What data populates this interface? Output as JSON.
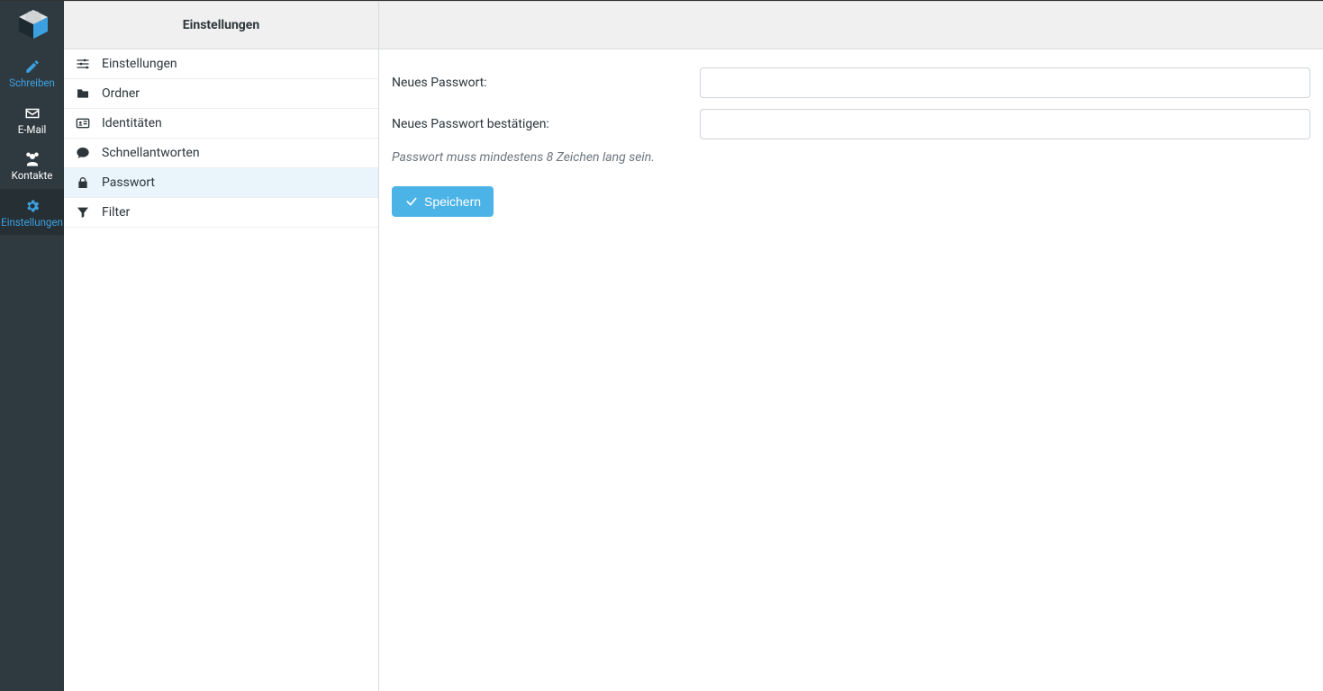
{
  "taskbar": {
    "items": [
      {
        "label": "Schreiben"
      },
      {
        "label": "E-Mail"
      },
      {
        "label": "Kontakte"
      },
      {
        "label": "Einstellungen"
      }
    ]
  },
  "settings_column": {
    "title": "Einstellungen",
    "items": [
      {
        "label": "Einstellungen"
      },
      {
        "label": "Ordner"
      },
      {
        "label": "Identitäten"
      },
      {
        "label": "Schnellantworten"
      },
      {
        "label": "Passwort"
      },
      {
        "label": "Filter"
      }
    ]
  },
  "form": {
    "new_password_label": "Neues Passwort:",
    "confirm_password_label": "Neues Passwort bestätigen:",
    "hint": "Passwort muss mindestens 8 Zeichen lang sein.",
    "save_label": "Speichern"
  }
}
